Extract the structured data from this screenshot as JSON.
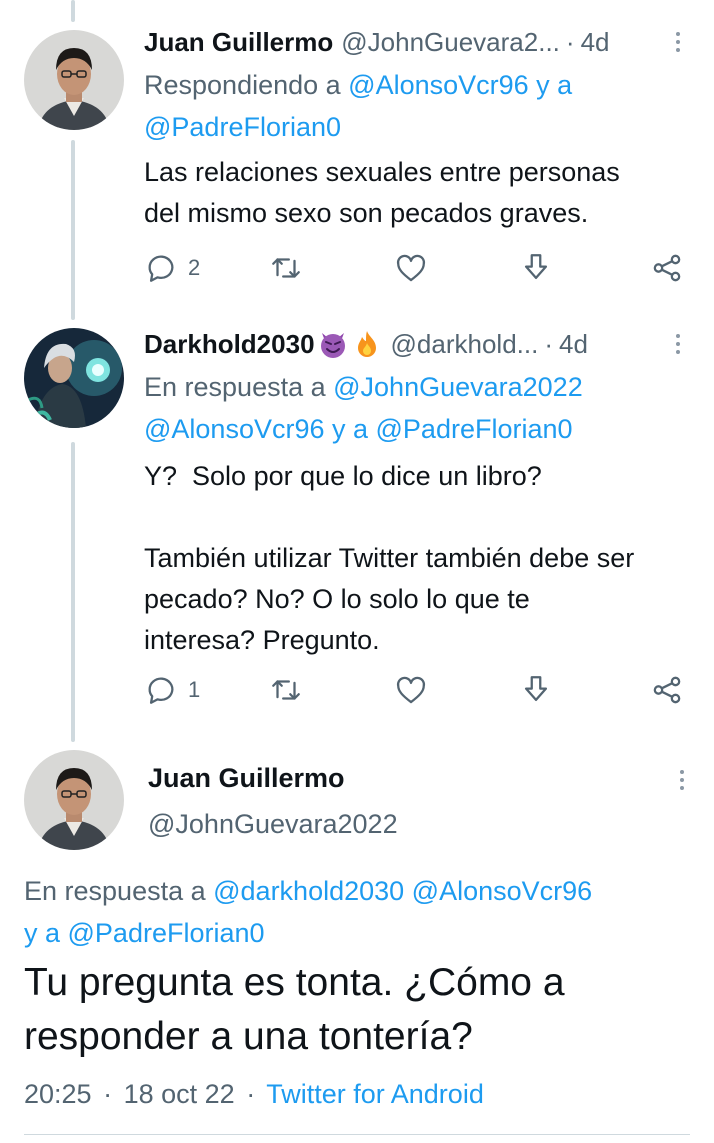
{
  "tweets": [
    {
      "name": "Juan Guillermo",
      "handle": "@JohnGuevara2...",
      "time": "4d",
      "replying_prefix": "Respondiendo a ",
      "replying_line1": "@AlonsoVcr96 y a",
      "replying_line2": "@PadreFlorian0",
      "text": "Las relaciones sexuales entre personas\ndel mismo sexo son pecados graves.",
      "reply_count": "2",
      "retweet_count": "",
      "like_count": ""
    },
    {
      "name": "Darkhold2030",
      "handle": "@darkhold...",
      "time": "4d",
      "replying_prefix": "En respuesta a ",
      "replying_line1": "@JohnGuevara2022",
      "replying_line2": "@AlonsoVcr96 y a @PadreFlorian0",
      "text": "Y?  Solo por que lo dice un libro?\n\nTambién utilizar Twitter también debe ser\npecado? No? O lo solo lo que te\ninteresa? Pregunto.",
      "reply_count": "1",
      "retweet_count": "",
      "like_count": ""
    }
  ],
  "main": {
    "name": "Juan Guillermo",
    "handle": "@JohnGuevara2022",
    "replying_prefix": "En respuesta a ",
    "replying_links1": "@darkhold2030 @AlonsoVcr96",
    "replying_links2": "y a @PadreFlorian0",
    "text": "Tu pregunta es tonta. ¿Cómo a responder a una tontería?",
    "time": "20:25",
    "date": "18 oct 22",
    "source": "Twitter for Android"
  },
  "separator": "·",
  "colors": {
    "accent": "#1d9bf0",
    "secondary": "#536471",
    "line": "#cfd9de"
  },
  "icons": [
    "reply-icon",
    "retweet-icon",
    "like-icon",
    "download-icon",
    "share-icon",
    "more-icon",
    "smiling-devil-emoji",
    "fire-emoji"
  ]
}
